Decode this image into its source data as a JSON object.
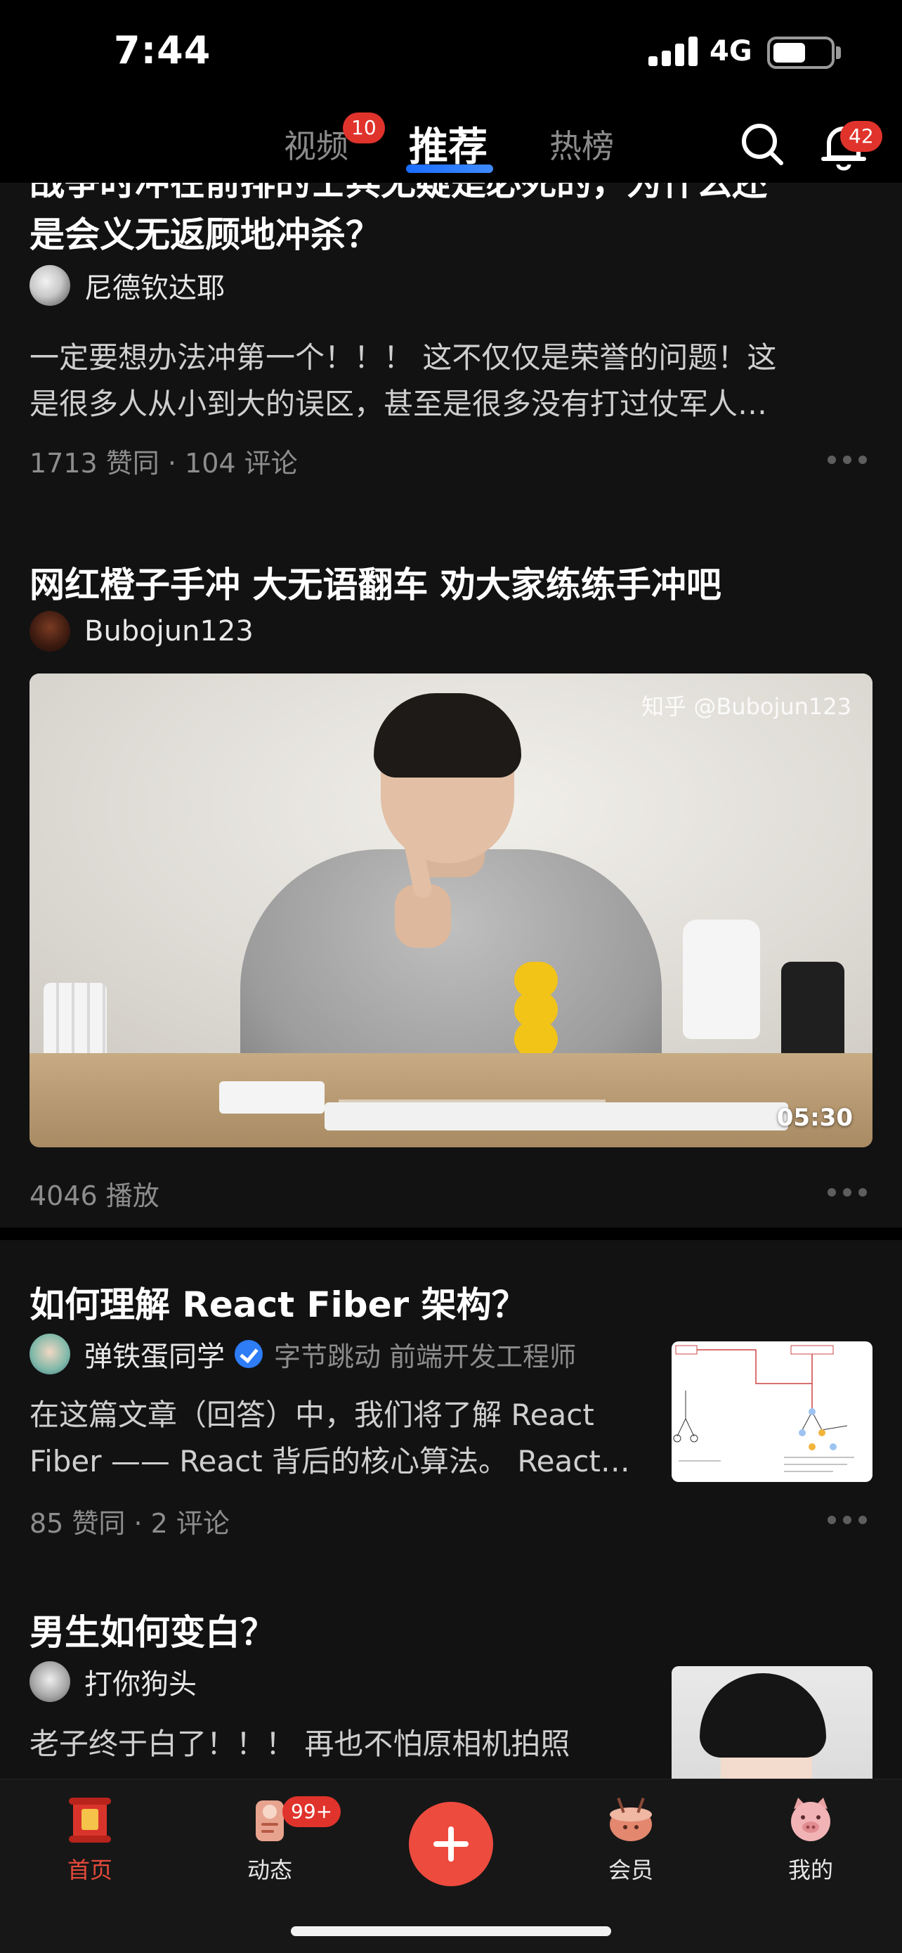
{
  "status_bar": {
    "time": "7:44",
    "network": "4G",
    "battery_level": 0.5
  },
  "top_nav": {
    "tabs": [
      {
        "label": "视频",
        "badge": "10"
      },
      {
        "label": "推荐",
        "active": true
      },
      {
        "label": "热榜"
      }
    ],
    "search_icon": "search-icon",
    "bell_icon": "bell-icon",
    "bell_badge": "42",
    "accent_color": "#1a6cff",
    "badge_color": "#e0332c"
  },
  "feed": [
    {
      "type": "answer",
      "title_partial": "战争时冲在前排的士兵无疑是必死的，为什么还",
      "title_line2": "是会义无返顾地冲杀？",
      "author": "尼德钦达耶",
      "excerpt_line1": "一定要想办法冲第一个！！！  这不仅仅是荣誉的问题！这",
      "excerpt_line2": "是很多人从小到大的误区，甚至是很多没有打过仗军人…",
      "meta": "1713 赞同 · 104 评论"
    },
    {
      "type": "video",
      "title": "网红橙子手冲 大无语翻车 劝大家练练手冲吧",
      "author": "Bubojun123",
      "watermark": "知乎 @Bubojun123",
      "duration": "05:30",
      "meta": "4046 播放"
    },
    {
      "type": "answer",
      "title": "如何理解 React Fiber 架构？",
      "author": "弹铁蛋同学",
      "author_desc": "字节跳动 前端开发工程师",
      "excerpt_line1": "在这篇文章（回答）中，我们将了解 React",
      "excerpt_line2": "Fiber —— React 背后的核心算法。 React…",
      "meta": "85 赞同 · 2 评论"
    },
    {
      "type": "answer",
      "title": "男生如何变白？",
      "author": "打你狗头",
      "excerpt_line1": "老子终于白了！！！ 再也不怕原相机拍照"
    }
  ],
  "tab_bar": {
    "tabs": [
      {
        "label": "首页",
        "icon": "home-scroll-icon",
        "active": true
      },
      {
        "label": "动态",
        "icon": "feed-icon",
        "badge": "99+"
      },
      {
        "label": "",
        "icon": "plus-icon"
      },
      {
        "label": "会员",
        "icon": "vip-icon"
      },
      {
        "label": "我的",
        "icon": "profile-pig-icon"
      }
    ],
    "active_color": "#e64a3b",
    "plus_color": "#ee4b3f"
  }
}
